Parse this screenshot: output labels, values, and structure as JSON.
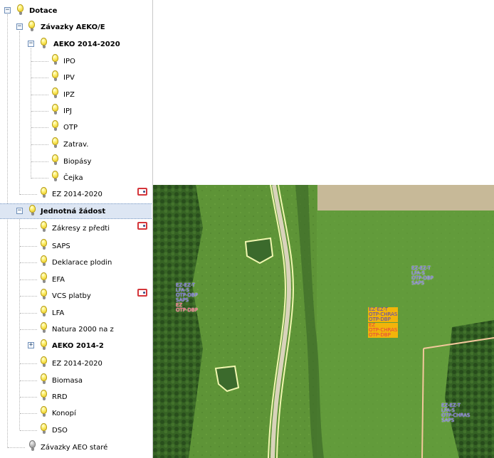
{
  "tree": {
    "items": [
      {
        "label": "Dotace",
        "bold": true
      },
      {
        "label": "Závazky AEKO/E",
        "bold": true
      },
      {
        "label": "AEKO 2014-2020",
        "bold": true
      },
      {
        "label": "IPO"
      },
      {
        "label": "IPV"
      },
      {
        "label": "IPZ"
      },
      {
        "label": "IPJ"
      },
      {
        "label": "OTP"
      },
      {
        "label": "Zatrav."
      },
      {
        "label": "Biopásy"
      },
      {
        "label": "Čejka"
      },
      {
        "label": "EZ 2014-2020",
        "legend": true
      },
      {
        "label": "Jednotná žádost",
        "bold": true,
        "selected": true
      },
      {
        "label": "Zákresy z předti",
        "legend": true
      },
      {
        "label": "SAPS"
      },
      {
        "label": "Deklarace plodin"
      },
      {
        "label": "EFA"
      },
      {
        "label": "VCS platby",
        "legend": true
      },
      {
        "label": "LFA"
      },
      {
        "label": "Natura 2000 na z"
      },
      {
        "label": "AEKO 2014-2",
        "bold": true
      },
      {
        "label": "EZ 2014-2020"
      },
      {
        "label": "Biomasa"
      },
      {
        "label": "RRD"
      },
      {
        "label": "Konopí"
      },
      {
        "label": "DSO"
      },
      {
        "label": "Závazky AEO staré",
        "disabled": true
      }
    ]
  },
  "map": {
    "labels": [
      {
        "lines": [
          {
            "t": "EZ-EZ-T",
            "c": "blue"
          },
          {
            "t": "LFA-S",
            "c": "blue"
          },
          {
            "t": "OTP-DBP",
            "c": "blue"
          },
          {
            "t": "SAPS",
            "c": "blue"
          },
          {
            "t": "EZ",
            "c": "red"
          },
          {
            "t": "OTP-DBP",
            "c": "red"
          }
        ]
      },
      {
        "lines": [
          {
            "t": "EZ-EZ-T",
            "c": "blue"
          },
          {
            "t": "LFA-S",
            "c": "blue"
          },
          {
            "t": "OTP-DBP",
            "c": "blue"
          },
          {
            "t": "SAPS",
            "c": "blue"
          }
        ]
      },
      {
        "lines": [
          {
            "t": "EZ-EZ-T",
            "c": "blue"
          },
          {
            "t": "OTP-CHRAS",
            "c": "blue"
          },
          {
            "t": "OTP-DBP",
            "c": "blue"
          },
          {
            "t": "EZ",
            "c": "red"
          },
          {
            "t": "OTP-CHRAS",
            "c": "red"
          },
          {
            "t": "OTP-DBP",
            "c": "red"
          }
        ]
      },
      {
        "lines": [
          {
            "t": "EZ-EZ-T",
            "c": "blue"
          },
          {
            "t": "LFA-S",
            "c": "blue"
          },
          {
            "t": "OTP-CHRAS",
            "c": "blue"
          },
          {
            "t": "SAPS",
            "c": "blue"
          }
        ]
      }
    ]
  }
}
